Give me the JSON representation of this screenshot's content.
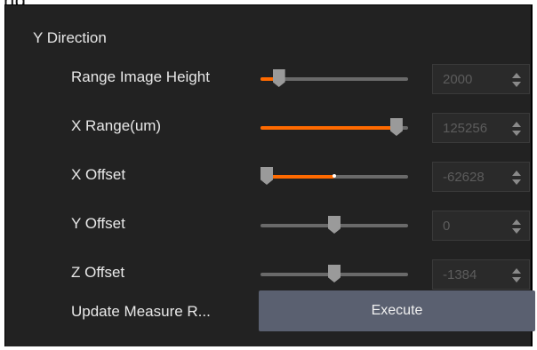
{
  "top_stub": {
    "text": "ng"
  },
  "section": {
    "title": "Y Direction"
  },
  "rows": [
    {
      "label": "Range Image Height",
      "value": "2000",
      "level": 0.09,
      "center_marker": false
    },
    {
      "label": "X Range(um)",
      "value": "125256",
      "level": 0.96,
      "center_marker": false
    },
    {
      "label": "X Offset",
      "value": "-62628",
      "level": 0.0,
      "center_marker": true
    },
    {
      "label": "Y Offset",
      "value": "0",
      "level": 0.5,
      "center_marker": true
    },
    {
      "label": "Z Offset",
      "value": "-1384",
      "level": 0.5,
      "center_marker": true
    }
  ],
  "update": {
    "label": "Update Measure R...",
    "button_label": "Execute"
  },
  "colors": {
    "accent": "#ff6a00",
    "panel_bg": "#222222",
    "button_bg": "#5a6070"
  }
}
